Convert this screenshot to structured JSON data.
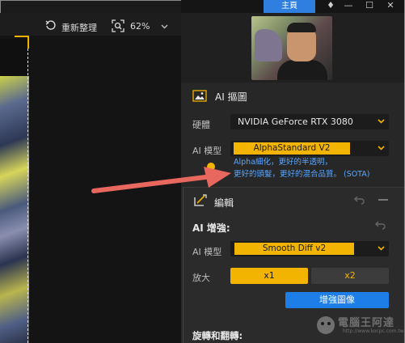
{
  "window": {
    "home_label": "主頁",
    "controls": [
      "♦",
      "—",
      "☐",
      "✕"
    ]
  },
  "toolbar": {
    "reset_label": "重新整理",
    "zoom_value": "62%",
    "icons": [
      "reset-icon",
      "zoom-icon",
      "chevron-down-icon"
    ]
  },
  "ai_matting": {
    "title": "AI 摳圖",
    "hardware_label": "硬體",
    "hardware_value": "NVIDIA GeForce RTX 3080",
    "model_label": "AI 模型",
    "model_value": "AlphaStandard  V2",
    "hint_line1": "Alpha細化，更好的半透明，",
    "hint_line2": "更好的頭髮，更好的混合品質。 (SOTA)"
  },
  "edit": {
    "title": "編輯",
    "enhance_heading": "AI 增強:",
    "model_label": "AI 模型",
    "model_value": "Smooth Diff v2",
    "zoom_label": "放大",
    "zoom_options": [
      "x1",
      "x2"
    ],
    "zoom_selected": "x1",
    "enhance_button": "增強圖像",
    "rotate_heading": "旋轉和翻轉:"
  },
  "watermark": {
    "text": "電腦王阿達",
    "url": "http://www.kocpc.com.tw"
  },
  "colors": {
    "accent_yellow": "#f2b400",
    "accent_blue": "#1e7ee8",
    "hint_blue": "#5aa7ff",
    "arrow_red": "#e8675e"
  }
}
